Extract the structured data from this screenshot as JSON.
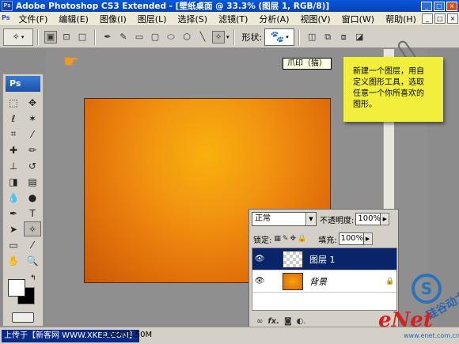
{
  "window": {
    "title": "Adobe Photoshop CS3 Extended - [壁纸桌面 @ 33.3% (图层 1, RGB/8)]",
    "app_badge": "Ps",
    "buttons": [
      "_",
      "□",
      "×"
    ]
  },
  "menu": {
    "items": [
      "文件(F)",
      "编辑(E)",
      "图像(I)",
      "图层(L)",
      "选择(S)",
      "滤镜(T)",
      "分析(A)",
      "视图(V)",
      "窗口(W)",
      "帮助(H)"
    ],
    "doc_buttons": [
      "_",
      "□",
      "×"
    ]
  },
  "options": {
    "shape_label": "形状:"
  },
  "toolbox": {
    "logo": "Ps"
  },
  "tooltip": "爪印（猫）",
  "note": {
    "text": "新建一个图层，用自\n定义图形工具，选取\n任意一个你所喜欢的\n图形。"
  },
  "layers_panel": {
    "blend_mode": "正常",
    "opacity_label": "不透明度:",
    "opacity_value": "100%",
    "lock_label": "锁定:",
    "fill_label": "填充:",
    "fill_value": "100%",
    "layers": [
      {
        "name": "图层 1",
        "selected": true
      },
      {
        "name": "背景",
        "selected": false,
        "locked": true
      }
    ],
    "bottom_icons": [
      "link-icon",
      "fx-icon",
      "mask-icon",
      "adjustment-icon"
    ]
  },
  "status": {
    "source": "上传于【新客网 WWW.XKER.COM】",
    "doc_info": "2.25M/1.50M"
  },
  "watermark": {
    "enet": "eNet",
    "cn": "硅谷动力",
    "url": "www.enet.com.cn"
  },
  "colors": {
    "titlebar": "#0642b6",
    "canvas_orange": "#f29410",
    "note_yellow": "#f1ef3c",
    "selected_layer": "#0a246a"
  }
}
